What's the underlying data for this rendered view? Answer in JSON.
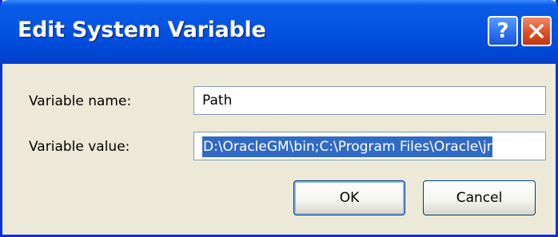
{
  "window": {
    "title": "Edit System Variable"
  },
  "title_buttons": {
    "help_label": "?",
    "help_icon": "help-icon",
    "close_icon": "close-icon"
  },
  "fields": {
    "name_label": "Variable name:",
    "name_value": "Path",
    "value_label": "Variable value:",
    "value_value": "D:\\OracleGM\\bin;C:\\Program Files\\Oracle\\jr"
  },
  "buttons": {
    "ok_label": "OK",
    "cancel_label": "Cancel"
  },
  "colors": {
    "titlebar": "#0554e3",
    "selection": "#316ac5",
    "dialog_bg": "#ece9d8",
    "close": "#dc4b1e"
  }
}
